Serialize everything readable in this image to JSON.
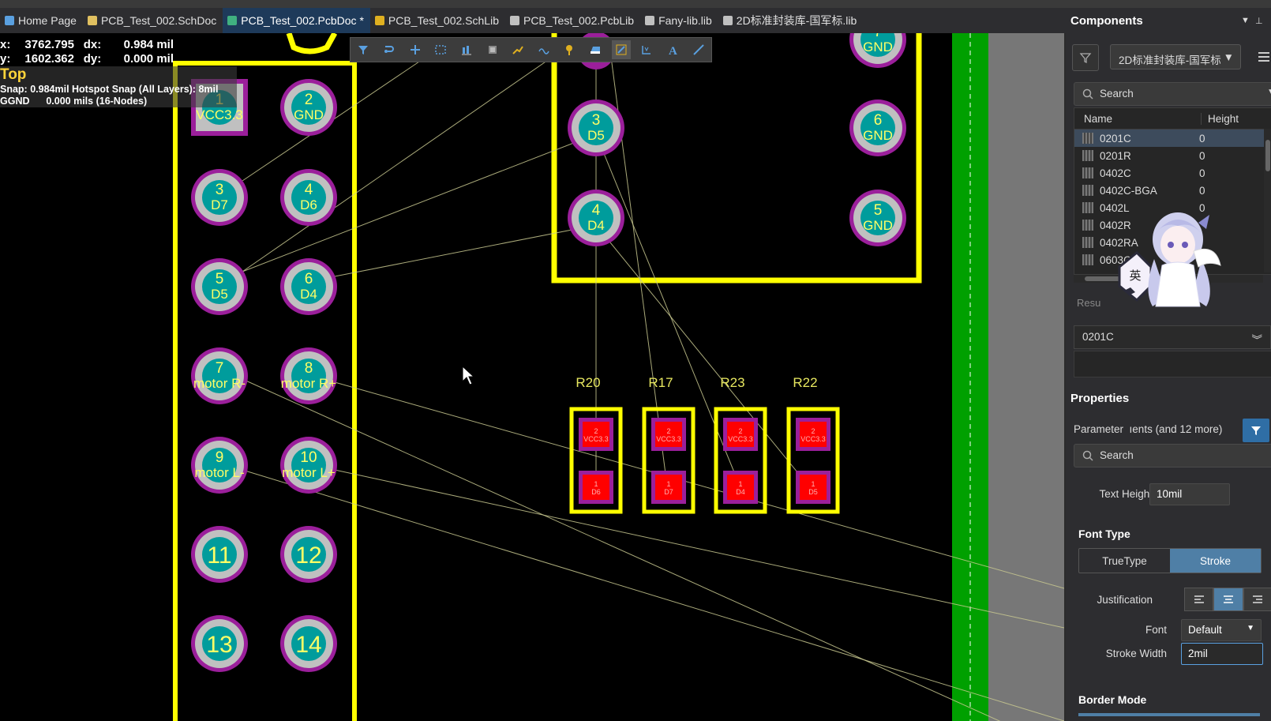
{
  "tabs": [
    {
      "label": "Home Page",
      "icon": "home-icon",
      "active": false
    },
    {
      "label": "PCB_Test_002.SchDoc",
      "icon": "schdoc-icon",
      "active": false
    },
    {
      "label": "PCB_Test_002.PcbDoc *",
      "icon": "pcbdoc-icon",
      "active": true
    },
    {
      "label": "PCB_Test_002.SchLib",
      "icon": "schlib-icon",
      "active": false
    },
    {
      "label": "PCB_Test_002.PcbLib",
      "icon": "pcblib-icon",
      "active": false
    },
    {
      "label": "Fany-lib.lib",
      "icon": "lib-icon",
      "active": false
    },
    {
      "label": "2D标准封装库-国军标.lib",
      "icon": "lib-icon",
      "active": false
    }
  ],
  "hud": {
    "x_label": "x:",
    "x_value": "3762.795",
    "dx_label": "dx:",
    "dx_value": "0.984 mil",
    "y_label": "y:",
    "y_value": "1602.362",
    "dy_label": "dy:",
    "dy_value": "0.000 mil",
    "layer": "Top",
    "snap": "Snap: 0.984mil Hotspot Snap (All Layers): 8mil",
    "net": "GGND      0.000 mils (16-Nodes)"
  },
  "pcb": {
    "header_pads": [
      {
        "num": "1",
        "net": "VCC3.3",
        "square": true
      },
      {
        "num": "2",
        "net": "GND"
      },
      {
        "num": "3",
        "net": "D7"
      },
      {
        "num": "4",
        "net": "D6"
      },
      {
        "num": "5",
        "net": "D5"
      },
      {
        "num": "6",
        "net": "D4"
      },
      {
        "num": "7",
        "net": "motor R-"
      },
      {
        "num": "8",
        "net": "motor R+"
      },
      {
        "num": "9",
        "net": "motor L-"
      },
      {
        "num": "10",
        "net": "motor L+"
      },
      {
        "num": "11",
        "net": ""
      },
      {
        "num": "12",
        "net": ""
      },
      {
        "num": "13",
        "net": ""
      },
      {
        "num": "14",
        "net": ""
      }
    ],
    "ic_pads": [
      {
        "num": "3",
        "net": "D5"
      },
      {
        "num": "4",
        "net": "D4"
      },
      {
        "num": "6",
        "net": "GND"
      },
      {
        "num": "5",
        "net": "GND"
      },
      {
        "num": "7",
        "net": "GND"
      }
    ],
    "resistors": [
      {
        "ref": "R20",
        "top_num": "2",
        "top_net": "VCC3.3",
        "bot_num": "1",
        "bot_net": "D6"
      },
      {
        "ref": "R17",
        "top_num": "2",
        "top_net": "VCC3.3",
        "bot_num": "1",
        "bot_net": "D7"
      },
      {
        "ref": "R23",
        "top_num": "2",
        "top_net": "VCC3.3",
        "bot_num": "1",
        "bot_net": "D4"
      },
      {
        "ref": "R22",
        "top_num": "2",
        "top_net": "VCC3.3",
        "bot_num": "1",
        "bot_net": "D5"
      }
    ]
  },
  "components_panel": {
    "title": "Components",
    "library": "2D标准封装库-国军标",
    "search_placeholder": "Search",
    "columns": [
      "Name",
      "Height"
    ],
    "rows": [
      {
        "name": "0201C",
        "height": "0",
        "selected": true
      },
      {
        "name": "0201R",
        "height": "0"
      },
      {
        "name": "0402C",
        "height": "0"
      },
      {
        "name": "0402C-BGA",
        "height": "0"
      },
      {
        "name": "0402L",
        "height": "0"
      },
      {
        "name": "0402R",
        "height": ""
      },
      {
        "name": "0402RA",
        "height": ""
      },
      {
        "name": "0603C",
        "height": ""
      }
    ],
    "results_label": "Resu",
    "selected_component": "0201C",
    "ime_label": "英"
  },
  "properties_panel": {
    "title": "Properties",
    "parameter_label": "Parameter",
    "parameter_value": "ıents (and 12 more)",
    "search_placeholder": "Search",
    "text_height_label": "Text Height",
    "text_height_value": "10mil",
    "font_type_label": "Font Type",
    "font_type_options": [
      "TrueType",
      "Stroke"
    ],
    "font_type_selected": "Stroke",
    "justification_label": "Justification",
    "font_label": "Font",
    "font_value": "Default",
    "stroke_width_label": "Stroke Width",
    "stroke_width_value": "2mil",
    "border_mode_label": "Border Mode"
  },
  "colors": {
    "canvas": "#000000",
    "silkscreen": "#ffff00",
    "pad_ring": "#c0c0c0",
    "pad_fill": "#009c9c",
    "pad_outline": "#9b1f9b",
    "smd_pad": "#ff0000",
    "pad_text": "#ffff66",
    "ratsnest": "#c8c890",
    "board_edge": "#00a000",
    "accent": "#4f7fa6"
  }
}
